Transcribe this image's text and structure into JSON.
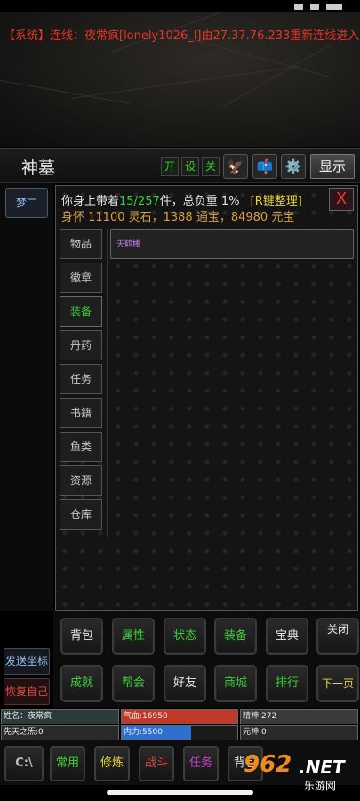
{
  "system_message": "【系统】连线：夜常疯[lonely1026_l]由27.37.76.233重新连线进入。",
  "map": {
    "title": "神墓",
    "toggles": [
      "开",
      "设",
      "关"
    ],
    "show_label": "显示"
  },
  "icons": {
    "eagle": "eagle-icon",
    "mail": "mailbox-icon",
    "settings": "gear-icon"
  },
  "channel_button": "梦二",
  "inventory": {
    "line1_prefix": "你身上带着",
    "line1_count": "15/257",
    "line1_suffix": "件，总负重 1%",
    "sort_label": "[R键整理]",
    "line2": "身怀 11100 灵石，1388 通宝，84980 元宝",
    "close_label": "X",
    "categories": [
      "物品",
      "徽章",
      "装备",
      "丹药",
      "任务",
      "书籍",
      "鱼类",
      "资源",
      "仓库"
    ],
    "active_category": "装备",
    "items": [
      "天鹤棒"
    ]
  },
  "side_buttons": [
    "发送坐标",
    "恢复自己"
  ],
  "game_buttons_row1": [
    "背包",
    "属性",
    "状态",
    "装备",
    "宝典",
    "关闭"
  ],
  "game_buttons_row2": [
    "成就",
    "帮会",
    "好友",
    "商城",
    "排行",
    "下一页"
  ],
  "stats": {
    "name": "姓名：夜常疯",
    "hp": "气血:16950",
    "spirit": "精神:272",
    "innate": "先天之炁:0",
    "mana": "内力:5500",
    "yuanshen": "元神:0",
    "mana_fraction": 0.6
  },
  "bottom_buttons": [
    "常用",
    "修炼",
    "战斗",
    "任务",
    "背包"
  ],
  "watermark": {
    "num": "962",
    "net": ".NET",
    "text": "乐游网"
  },
  "colors": {
    "system": "#e6342b",
    "green": "#3fcf3a",
    "yellow": "#e7d538",
    "purple": "#c07cf0",
    "hp": "#c0392b",
    "mana": "#2f6fd0"
  }
}
